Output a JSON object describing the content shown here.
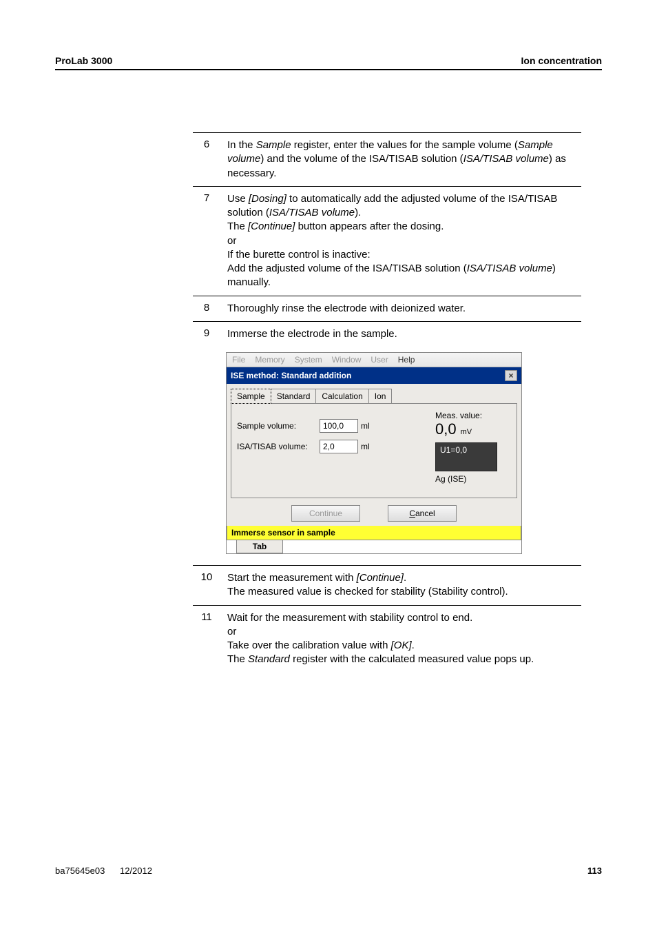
{
  "page": {
    "header_left": "ProLab 3000",
    "header_right": "Ion concentration",
    "footer_id": "ba75645e03",
    "footer_date": "12/2012",
    "footer_page": "113"
  },
  "steps": {
    "s6": {
      "n": "6",
      "t1": "In the ",
      "i1": "Sample",
      "t2": " register, enter the values for the sample volume (",
      "i2": "Sample volume",
      "t3": ") and the volume of the ISA/TISAB solution (",
      "i3": "ISA/TISAB volume",
      "t4": ") as necessary."
    },
    "s7": {
      "n": "7",
      "t1": "Use ",
      "i1": "[Dosing]",
      "t2": " to automatically add the adjusted volume of the ISA/TISAB solution (",
      "i2": "ISA/TISAB volume",
      "t3": ").",
      "l2a": "The ",
      "l2i": "[Continue]",
      "l2b": " button appears after the dosing.",
      "l3": "or",
      "l4": "If the burette control is inactive:",
      "l5a": "Add the adjusted volume of the ISA/TISAB solution (",
      "l5i": "ISA/TISAB volume",
      "l5b": ") manually."
    },
    "s8": {
      "n": "8",
      "t": "Thoroughly rinse the electrode with deionized water."
    },
    "s9": {
      "n": "9",
      "t": "Immerse the electrode in the sample."
    },
    "s10": {
      "n": "10",
      "t1": "Start the measurement with ",
      "i1": "[Continue]",
      "t2": ".",
      "l2": "The measured value is checked for stability (Stability control)."
    },
    "s11": {
      "n": "11",
      "l1": "Wait for the measurement with stability control to end.",
      "l2": "or",
      "l3a": "Take over the calibration value with ",
      "l3i": "[OK]",
      "l3b": ".",
      "l4a": "The ",
      "l4i": "Standard",
      "l4b": " register with the calculated measured value pops up."
    }
  },
  "win": {
    "menu": {
      "file": "File",
      "memory": "Memory",
      "system": "System",
      "window": "Window",
      "user": "User",
      "help": "Help"
    },
    "title": "ISE method:  Standard addition",
    "close": "×",
    "tabs": {
      "sample": "Sample",
      "standard": "Standard",
      "calc": "Calculation",
      "ion": "Ion"
    },
    "fields": {
      "sv_label": "Sample volume:",
      "sv_value": "100,0",
      "sv_unit": "ml",
      "iv_label": "ISA/TISAB volume:",
      "iv_value": "2,0",
      "iv_unit": "ml"
    },
    "readout": {
      "lab": "Meas. value:",
      "val": "0,0",
      "unit": "mV",
      "u1": "U1=0,0",
      "sub": "Ag (ISE)"
    },
    "buttons": {
      "cont": "Continue",
      "cancel": "Cancel",
      "cancel_u": "C"
    },
    "status": "Immerse sensor in sample",
    "tabind": "Tab"
  }
}
